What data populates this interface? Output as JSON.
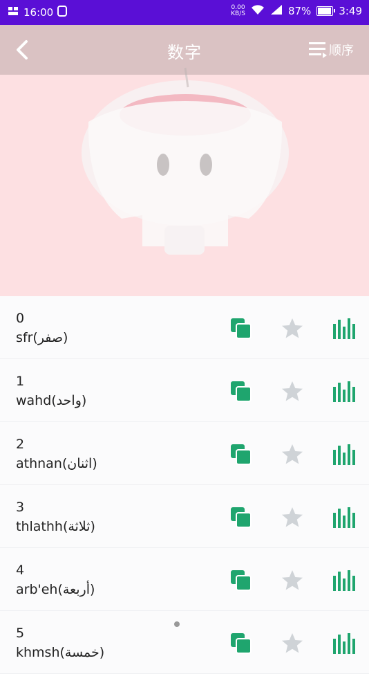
{
  "status": {
    "time": "16:00",
    "net_speed": "0.00",
    "net_unit": "KB/S",
    "battery": "87%",
    "battery_fraction": 0.87,
    "clock": "3:49"
  },
  "header": {
    "title": "数字",
    "order_label": "顺序"
  },
  "colors": {
    "status_bar": "#5a0fd6",
    "accent_green": "#1fa56e",
    "star_grey": "#cfd3d7",
    "hero_bg": "#fde0e2"
  },
  "items": [
    {
      "number": "0",
      "word": "sfr(صفر)"
    },
    {
      "number": "1",
      "word": "wahd(واحد)"
    },
    {
      "number": "2",
      "word": "athnan(اثنان)"
    },
    {
      "number": "3",
      "word": "thlathh(ثلاثة)"
    },
    {
      "number": "4",
      "word": "arb'eh(أربعة)"
    },
    {
      "number": "5",
      "word": "khmsh(خمسة)"
    }
  ]
}
